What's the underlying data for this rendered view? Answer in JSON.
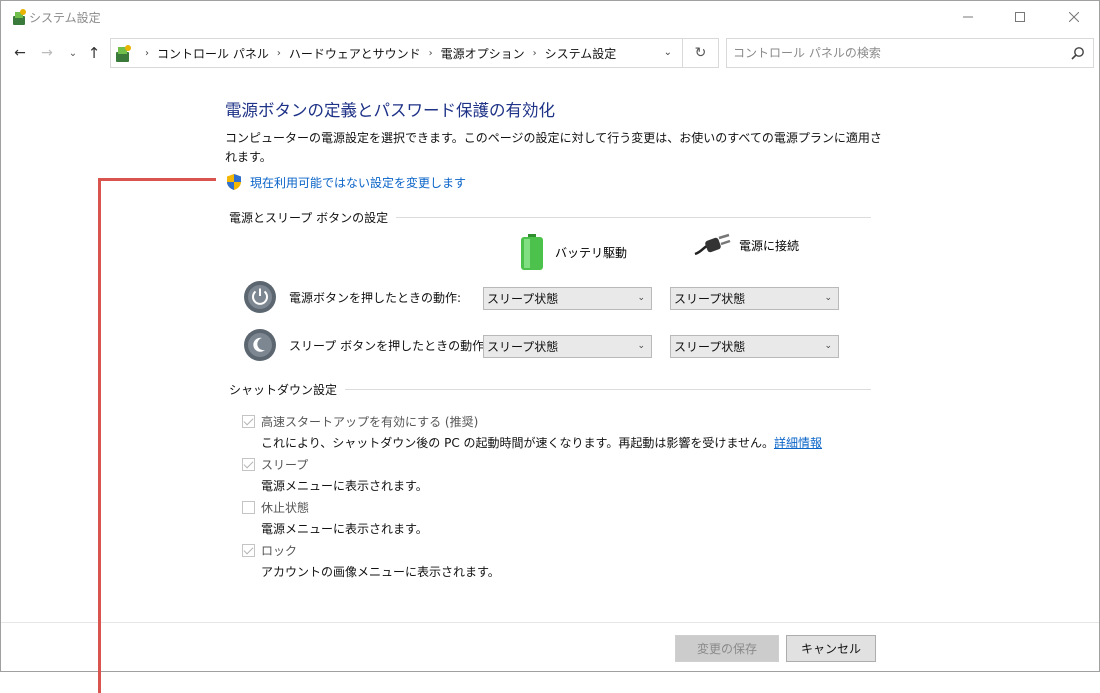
{
  "window": {
    "title": "システム設定",
    "controls": {
      "minimize": "minimize",
      "maximize": "maximize",
      "close": "close"
    }
  },
  "address_bar": {
    "breadcrumbs": [
      "コントロール パネル",
      "ハードウェアとサウンド",
      "電源オプション",
      "システム設定"
    ]
  },
  "search": {
    "placeholder": "コントロール パネルの検索"
  },
  "page": {
    "title": "電源ボタンの定義とパスワード保護の有効化",
    "description": "コンピューターの電源設定を選択できます。このページの設定に対して行う変更は、お使いのすべての電源プランに適用されます。",
    "change_link": "現在利用可能ではない設定を変更します"
  },
  "power_buttons": {
    "section_title": "電源とスリープ ボタンの設定",
    "col_battery": "バッテリ駆動",
    "col_plugged": "電源に接続",
    "rows": [
      {
        "label": "電源ボタンを押したときの動作:",
        "battery": "スリープ状態",
        "plugged": "スリープ状態"
      },
      {
        "label": "スリープ ボタンを押したときの動作:",
        "battery": "スリープ状態",
        "plugged": "スリープ状態"
      }
    ]
  },
  "shutdown": {
    "section_title": "シャットダウン設定",
    "items": [
      {
        "title": "高速スタートアップを有効にする (推奨)",
        "desc": "これにより、シャットダウン後の PC の起動時間が速くなります。再起動は影響を受けません。",
        "link": "詳細情報",
        "checked": true
      },
      {
        "title": "スリープ",
        "desc": "電源メニューに表示されます。",
        "checked": true
      },
      {
        "title": "休止状態",
        "desc": "電源メニューに表示されます。",
        "checked": false
      },
      {
        "title": "ロック",
        "desc": "アカウントの画像メニューに表示されます。",
        "checked": true
      }
    ]
  },
  "footer": {
    "save": "変更の保存",
    "cancel": "キャンセル"
  },
  "colors": {
    "title": "#1e3287",
    "link": "#0a64c8",
    "callout": "#d9534f"
  }
}
